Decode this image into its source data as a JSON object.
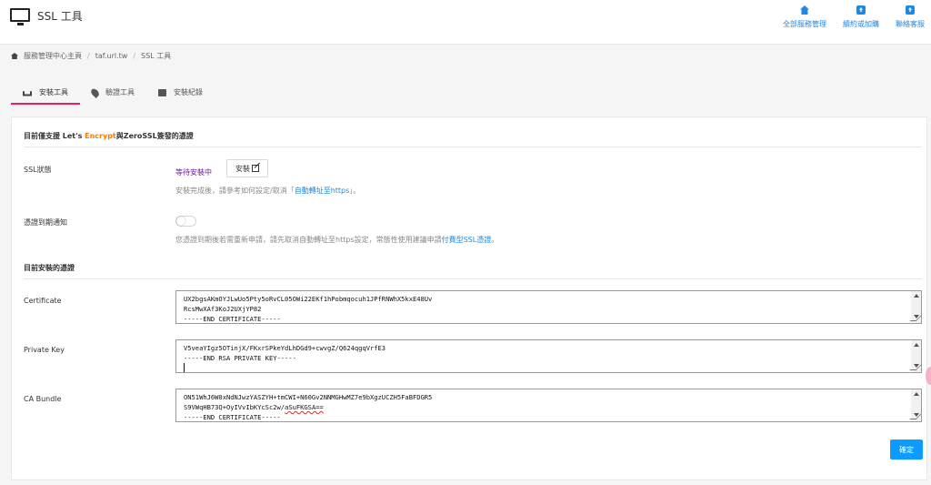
{
  "app": {
    "title": "SSL 工具",
    "colors": {
      "accent": "#1e88e5",
      "tab_active": "#e91e63",
      "confirm": "#0d9bff"
    }
  },
  "top_nav": [
    {
      "label": "全部服務管理",
      "icon": "home-icon"
    },
    {
      "label": "續約或加購",
      "icon": "upload-file-icon"
    },
    {
      "label": "聯絡客服",
      "icon": "upload-file-icon"
    }
  ],
  "breadcrumb": [
    {
      "label": "服務管理中心主頁"
    },
    {
      "label": "taf.url.tw"
    },
    {
      "label": "SSL 工具"
    }
  ],
  "tabs": [
    {
      "label": "安裝工具",
      "icon": "install-icon",
      "active": true
    },
    {
      "label": "驗證工具",
      "icon": "pin-icon",
      "active": false
    },
    {
      "label": "安裝紀錄",
      "icon": "briefcase-icon",
      "active": false
    }
  ],
  "notice": {
    "prefix": "目前僅支援 Let's ",
    "highlight": "Encrypt",
    "suffix": "與ZeroSSL簽發的憑證"
  },
  "ssl_status": {
    "label": "SSL狀態",
    "value": "等待安裝中",
    "button": "安裝",
    "help_before": "安裝完成後，請參考如何設定/取消「",
    "help_link": "自動轉址至https",
    "help_after": "」。"
  },
  "expiry": {
    "label": "憑證到期通知",
    "help": "您憑證到期後若需重新申請，請先取消自動轉址至https設定，常態性使用建議申請",
    "help_link": "付費型SSL憑證",
    "help_end": "。"
  },
  "current_title": "目前安裝的憑證",
  "certificate": {
    "label": "Certificate",
    "lines": [
      "UX2bgsAKmOYJLwUo5Pty5oRvCL05OWi22EKf1hPobmqocuh1JPfRNWhX5kxE48Uv",
      "RcsMwXAf3KoJ2UXjYP82",
      "-----END CERTIFICATE-----"
    ]
  },
  "private_key": {
    "label": "Private Key",
    "lines": [
      "V5veaYIgz5OTinjX/FKxrSPkeYdLhDGd9+cwvgZ/Q624qgqVrfE3",
      "-----END RSA PRIVATE KEY-----",
      ""
    ]
  },
  "ca_bundle": {
    "label": "CA Bundle",
    "lines": [
      "ON51WhJ6W0xNdNJwzYASZYH+tmCWI+N60Gv2NNMGHwMZ7e9bXgzUCZH5FaBFDGR5",
      "S9VWqHB73Q+OyIVvIbKYcSc2w/",
      "-----END CERTIFICATE-----"
    ],
    "underlined": "aSuFKGSA=="
  },
  "confirm_button": "確定"
}
